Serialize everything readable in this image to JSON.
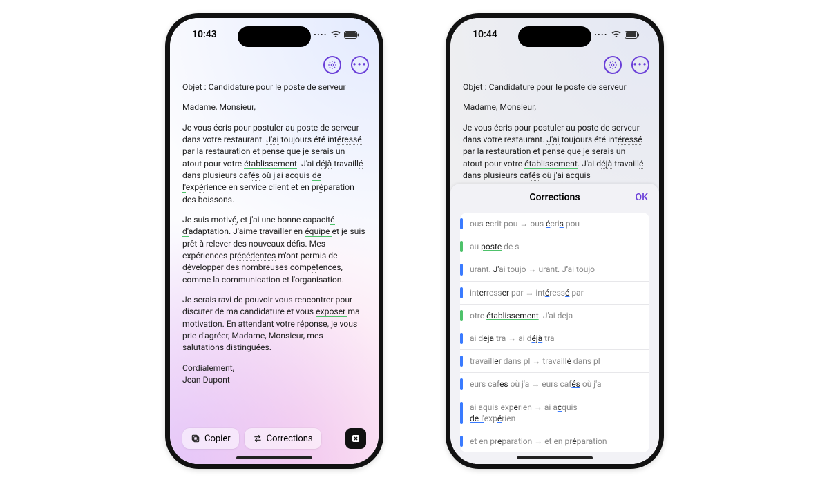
{
  "phone1": {
    "time": "10:43"
  },
  "phone2": {
    "time": "10:44"
  },
  "subject": "Objet : Candidature pour le poste de serveur",
  "greeting": "Madame, Monsieur,",
  "para1": {
    "t0": "Je vous ",
    "w_ecris": "écris",
    "t1": " pour postuler au ",
    "w_poste": "poste ",
    "t2": "de serveur dans votre restaurant. ",
    "w_jai": "J'ai",
    "t3": " toujours été int",
    "w_eresse": "éressé",
    "t4": " par la restauration et pense que je serais un atout pour votre ",
    "w_etab": "établissement",
    "t5": ". J'ai d",
    "w_eja": "éjà",
    "t6": " travaill",
    "w_e1": "é",
    "t7": " dans plusieurs caf",
    "w_es": "és",
    "t8": " où j'ai acquis ",
    "w_del": "de l'",
    "t9": "exp",
    "w_e2": "é",
    "t10": "rience en service client et en pr",
    "w_e3": "é",
    "t11": "paration des boissons."
  },
  "para2": {
    "t0": "Je suis motiv",
    "w_e0": "é,",
    "t1": " et j'ai une bonne capacit",
    "w_e1": "é d'",
    "t2": "adaptation. J'aime travailler en ",
    "w_equipe": "équipe ",
    "t3": "et je suis prêt à relever des nouveaux défis. Mes expériences pr",
    "w_eced": "écédentes",
    "t4": " m'ont permis de d",
    "w_e2": "é",
    "t5": "velopper des nombreuses comp",
    "w_e3": "é",
    "t6": "tences, comme la communication et ",
    "w_lorg": "l'",
    "t7": "organisation."
  },
  "para3": {
    "t0": "Je serais ravi de pouvoir vous ",
    "w_renc": "rencontrer ",
    "t1": "pour discuter de ma candidature et vous ",
    "w_exp": "exposer ",
    "t2": "ma motivation. En attendant votre ",
    "w_rep": "réponse,",
    "t3": " je vous prie d'agréer, Madame, Monsieur, mes salutations distinguées."
  },
  "signoff": "Cordialement,",
  "name": "Jean Dupont",
  "buttons": {
    "copy": "Copier",
    "corrections": "Corrections"
  },
  "sheet": {
    "title": "Corrections",
    "ok": "OK"
  },
  "corr": [
    {
      "bar": "blue",
      "b0": "ous ",
      "b1": "e",
      "b2": "crit pou",
      "arrow": "→",
      "a0": "ous ",
      "a1": "é",
      "a2": "cri",
      "a3": "s",
      "a4": " pou"
    },
    {
      "bar": "green",
      "b0": "au ",
      "b1": "poste",
      "b2": " de s"
    },
    {
      "bar": "blue",
      "b0": "urant. ",
      "b1": "J'",
      "b2": "ai toujo",
      "arrow": "→",
      "a0": "urant. J",
      "a1": "'",
      "a2": "ai toujo"
    },
    {
      "bar": "blue",
      "b0": "int",
      "b1": "er",
      "b2": "ress",
      "b3": "er",
      "b4": " par",
      "arrow": "→",
      "a0": "int",
      "a1": "é",
      "a2": "ress",
      "a3": "é",
      "a4": " par"
    },
    {
      "bar": "green",
      "b0": "otre ",
      "b1": "établissement",
      "b2": ". J'ai deja"
    },
    {
      "bar": "blue",
      "b0": "ai d",
      "b1": "eja",
      "b2": " tra",
      "arrow": "→",
      "a0": "ai d",
      "a1": "éjà",
      "a2": " tra"
    },
    {
      "bar": "blue",
      "b0": "travaill",
      "b1": "er",
      "b2": " dans pl",
      "arrow": "→",
      "a0": "travaill",
      "a1": "é",
      "a2": " dans pl"
    },
    {
      "bar": "blue",
      "b0": "eurs caf",
      "b1": "es",
      "b2": " où j'a",
      "arrow": "→",
      "a0": "eurs caf",
      "a1": "és",
      "a2": " où j'a"
    },
    {
      "bar": "blue",
      "b0": "ai aquis exp",
      "b1": "e",
      "b2": "rien",
      "arrow": "→",
      "a0": "ai a",
      "a1": "c",
      "a2": "quis ",
      "line2a": "de l'",
      "line2b": "exp",
      "line2c": "é",
      "line2d": "rien"
    },
    {
      "bar": "blue",
      "b0": "et en pr",
      "b1": "e",
      "b2": "paration",
      "arrow": "→",
      "a0": "et en pr",
      "a1": "é",
      "a2": "paration"
    }
  ]
}
